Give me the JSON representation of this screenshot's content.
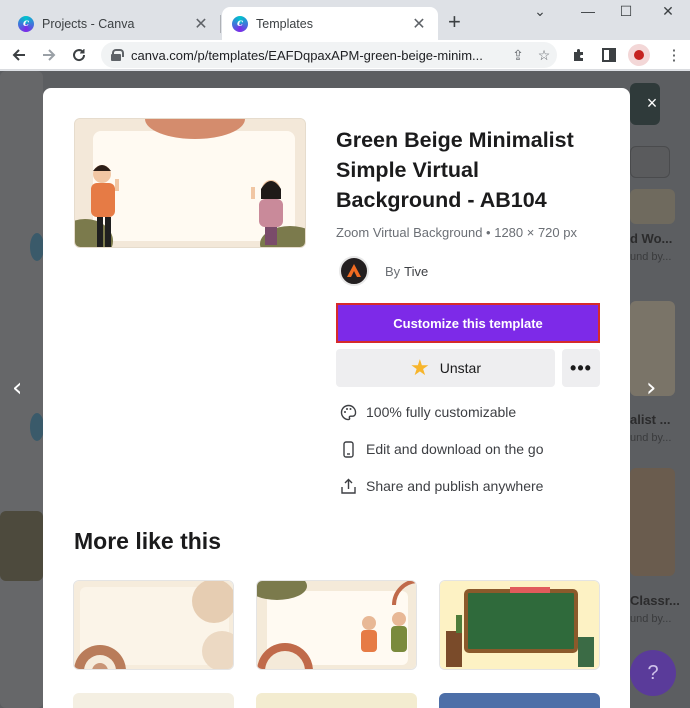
{
  "browser": {
    "tabs": [
      {
        "title": "Projects - Canva",
        "active": false,
        "icon": "canva-favicon"
      },
      {
        "title": "Templates",
        "active": true,
        "icon": "canva-favicon"
      }
    ],
    "new_tab_symbol": "+",
    "url": "canva.com/p/templates/EAFDqpaxAPM-green-beige-minim..."
  },
  "background": {
    "labels": [
      "d Wo...",
      "und by...",
      "alist ...",
      "und by...",
      "Classr...",
      "und by..."
    ],
    "help_symbol": "?"
  },
  "modal": {
    "close_symbol": "×",
    "title": "Green Beige Minimalist Simple Virtual Background - AB104",
    "subtitle": "Zoom Virtual Background • 1280 × 720 px",
    "author_prefix": "By",
    "author_name": "Tive",
    "customize_label": "Customize this template",
    "unstar_label": "Unstar",
    "more_options_symbol": "•••",
    "features": [
      {
        "icon": "palette-icon",
        "label": "100% fully customizable"
      },
      {
        "icon": "mobile-phone-icon",
        "label": "Edit and download on the go"
      },
      {
        "icon": "share-upload-icon",
        "label": "Share and publish anywhere"
      }
    ],
    "more_like_this_title": "More like this"
  },
  "colors": {
    "accent_purple": "#7d2ae8",
    "highlight_red": "#d62b2b",
    "star_yellow": "#f7b52c"
  }
}
